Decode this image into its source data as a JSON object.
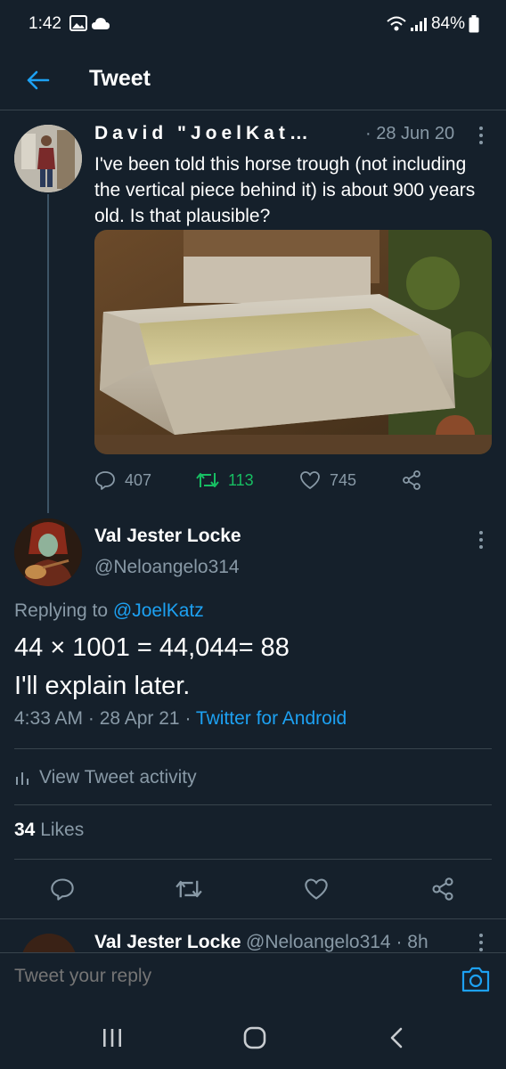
{
  "status_bar": {
    "time": "1:42",
    "battery": "84%"
  },
  "header": {
    "title": "Tweet"
  },
  "parent_tweet": {
    "display_name": "David \"JoelKat…",
    "date": "· 28 Jun 20",
    "text": "I've been told this horse trough (not including the vertical piece behind it) is about 900 years old. Is that plausible?",
    "replies": "407",
    "retweets": "113",
    "likes": "745"
  },
  "main_tweet": {
    "display_name": "Val Jester Locke",
    "handle": "@Neloangelo314",
    "replying_prefix": "Replying to",
    "replying_to": "@JoelKatz",
    "text_line1": "44 × 1001 = 44,044= 88",
    "text_line2": "I'll explain later.",
    "timestamp": "4:33 AM · 28 Apr 21 ·",
    "source": "Twitter for Android",
    "activity_label": "View Tweet activity",
    "likes_count": "34",
    "likes_label": "Likes"
  },
  "reply_preview": {
    "display_name": "Val Jester Locke",
    "handle_time": "@Neloangelo314 · 8h"
  },
  "compose": {
    "placeholder": "Tweet your reply"
  },
  "colors": {
    "background": "#15202b",
    "accent": "#1da1f2",
    "muted": "#8899a6",
    "retweet": "#17bf63",
    "divider": "#38444d"
  }
}
